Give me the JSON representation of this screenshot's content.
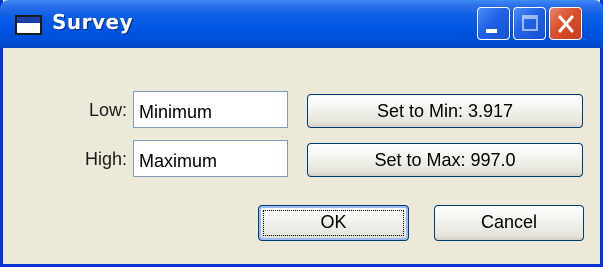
{
  "window": {
    "title": "Survey"
  },
  "titlebar_buttons": {
    "minimize": "minimize",
    "maximize": "maximize",
    "close": "close"
  },
  "form": {
    "low": {
      "label": "Low:",
      "value": "Minimum",
      "set_button": "Set to Min: 3.917"
    },
    "high": {
      "label": "High:",
      "value": "Maximum",
      "set_button": "Set to Max: 997.0"
    }
  },
  "actions": {
    "ok": "OK",
    "cancel": "Cancel"
  },
  "colors": {
    "titlebar": "#0055e5",
    "window_frame": "#0831d9",
    "dialog_face": "#ece9d8",
    "close_button": "#d9502c"
  }
}
